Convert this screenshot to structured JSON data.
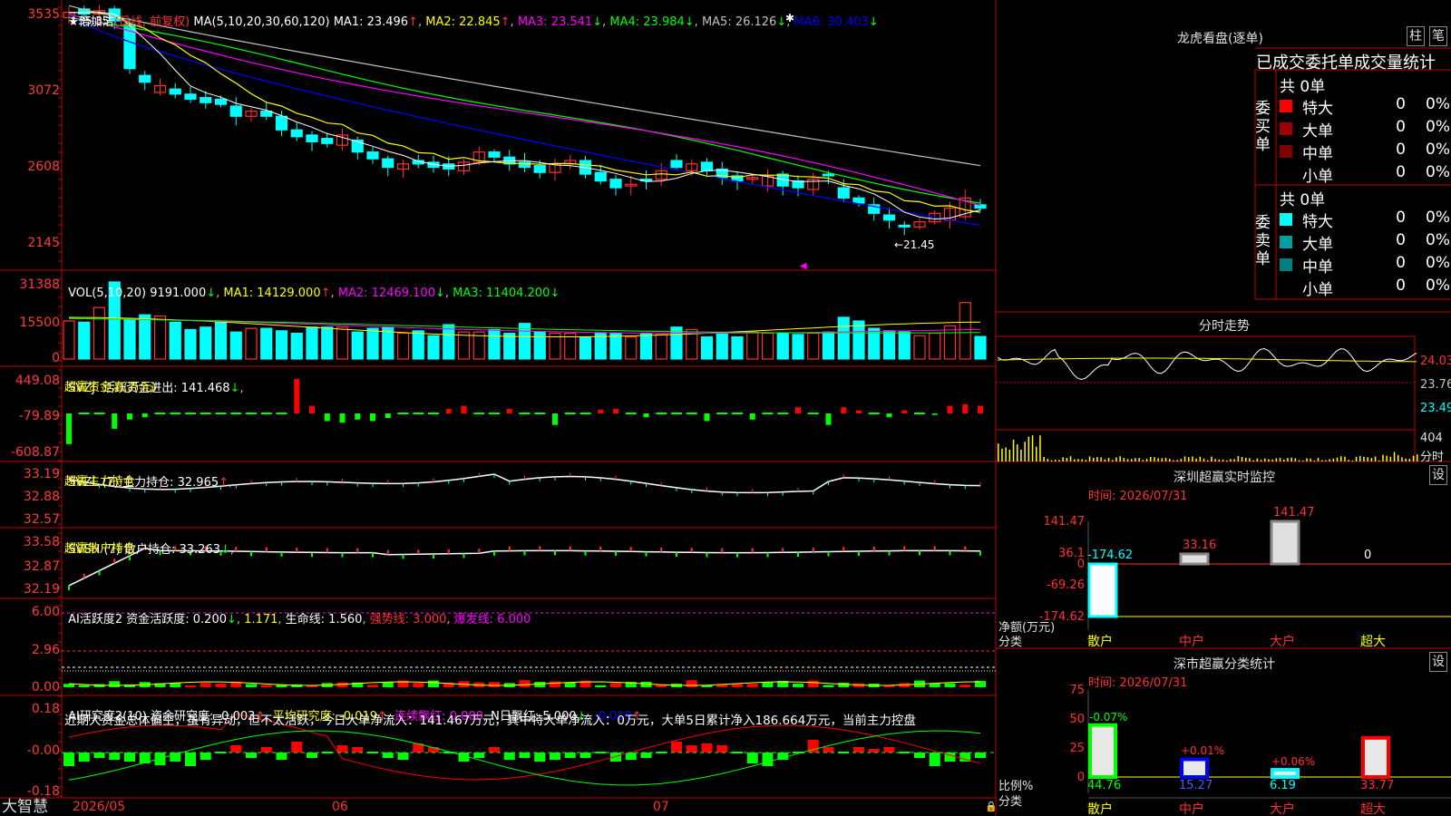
{
  "stock": {
    "star": "★",
    "name": "倍加洁",
    "period": "(日线, 前复权)",
    "ma_params": "MA(5,10,20,30,60,120)",
    "ma": [
      {
        "label": "MA1:",
        "value": "23.496",
        "arrow": "↑",
        "color": "#ffffff"
      },
      {
        "label": "MA2:",
        "value": "22.845",
        "arrow": "↑",
        "color": "#ffff00"
      },
      {
        "label": "MA3:",
        "value": "23.541",
        "arrow": "↓",
        "color": "#ff00ff"
      },
      {
        "label": "MA4:",
        "value": "23.984",
        "arrow": "↓",
        "color": "#00ff00"
      },
      {
        "label": "MA5:",
        "value": "26.126",
        "arrow": "↓",
        "color": "#c0c0c0"
      },
      {
        "label": "MA6:",
        "value": "30.403",
        "arrow": "↓",
        "color": "#0000ff"
      }
    ],
    "high_mark": "35.35",
    "low_mark": "←21.45",
    "y_labels": [
      "3535",
      "3072",
      "2608",
      "2145"
    ]
  },
  "vol": {
    "header": "VOL(5,10,20)",
    "value": "9191.000",
    "value_arrow": "↓",
    "ma": [
      {
        "label": "MA1:",
        "value": "14129.000",
        "arrow": "↑",
        "color": "#ffff00"
      },
      {
        "label": "MA2:",
        "value": "12469.100",
        "arrow": "↓",
        "color": "#ff00ff"
      },
      {
        "label": "MA3:",
        "value": "11404.200",
        "arrow": "↓",
        "color": "#00ff00"
      }
    ],
    "y_labels": [
      "31388",
      "15500",
      "0"
    ]
  },
  "svzj": {
    "header": "SVZJ  活跃资金进出: 141.468",
    "arrow": "↓",
    "sub": "超赢资金流(万元)",
    "y_labels": [
      "449.08",
      "-79.89",
      "-608.87"
    ]
  },
  "svzl": {
    "header": "SVZL (7) 主力持仓: 32.965",
    "arrow": "↑",
    "sub": "超赢主力持仓",
    "y_labels": [
      "33.19",
      "32.88",
      "32.57"
    ]
  },
  "svsh": {
    "header": "SVSH (7) 散户持仓: 33.263",
    "arrow": "↓",
    "sub": "超赢散户持仓",
    "y_labels": [
      "33.58",
      "32.87",
      "32.19"
    ]
  },
  "ai2": {
    "header": "AI活跃度2 资金活跃度: 0.200",
    "arrow": "↓",
    "v2": "1.171",
    "life": "生命线: 1.560",
    "strong": "强势线: 3.000",
    "burst": "爆发线: 6.000",
    "y_labels": [
      "6.00",
      "2.96",
      "0.00"
    ]
  },
  "ai_research": {
    "header": "AI研究度2(10) 资金研究度: -0.003",
    "arrow": "↑",
    "avg": "平均研究度: -0.019",
    "avg_arrow": "↑",
    "red": "连续飘红: 0.000",
    "nday": "N日飘红: 5.000",
    "nday_arrow": "↓",
    "last": "-0.019",
    "last_arrow": "↑",
    "comment": "近期大资金总体偏空，虽有异动，但不太活跃，今日大单净流入：141.467万元，其中特大单净流入：0万元，大单5日累计净入186.664万元，当前主力控盘",
    "y_labels": [
      "0.18",
      "-0.00",
      "-0.18"
    ]
  },
  "footer": {
    "brand": "大智慧",
    "dates": [
      "2026/05",
      "06",
      "07"
    ]
  },
  "dragon": {
    "title": "龙虎看盘(逐单)",
    "btn1": "柱",
    "btn2": "笔",
    "heading": "已成交委托单成交量统计",
    "buy_label": "委买单",
    "sell_label": "委卖单",
    "total_buy": "共 0单",
    "total_sell": "共 0单",
    "buy_rows": [
      {
        "name": "特大",
        "count": "0",
        "pct": "0%",
        "color": "#ff0000"
      },
      {
        "name": "大单",
        "count": "0",
        "pct": "0%",
        "color": "#a00000"
      },
      {
        "name": "中单",
        "count": "0",
        "pct": "0%",
        "color": "#800000"
      },
      {
        "name": "小单",
        "count": "0",
        "pct": "0%",
        "color": ""
      }
    ],
    "sell_rows": [
      {
        "name": "特大",
        "count": "0",
        "pct": "0%",
        "color": "#00ffff"
      },
      {
        "name": "大单",
        "count": "0",
        "pct": "0%",
        "color": "#00a0a0"
      },
      {
        "name": "中单",
        "count": "0",
        "pct": "0%",
        "color": "#008080"
      },
      {
        "name": "小单",
        "count": "0",
        "pct": "0%",
        "color": ""
      }
    ]
  },
  "minute": {
    "title": "分时走势",
    "y_labels": [
      "24.03",
      "23.76",
      "23.49"
    ],
    "vol_label": "404",
    "vol_unit": "分时"
  },
  "sz_monitor": {
    "title": "深圳超赢实时监控",
    "btn": "设",
    "time": "时间: 2026/07/31",
    "y_labels": [
      "141.47",
      "36.1",
      "0",
      "-69.26",
      "-174.62"
    ],
    "ylabel": "净额(万元)",
    "xlabel": "分类",
    "chart_data": {
      "type": "bar",
      "categories": [
        "散户",
        "中户",
        "大户",
        "超大"
      ],
      "values": [
        -174.62,
        33.16,
        141.47,
        0
      ],
      "value_labels": [
        "-174.62",
        "33.16",
        "141.47",
        "0"
      ],
      "ylim": [
        -174.62,
        141.47
      ]
    }
  },
  "sz_class": {
    "title": "深市超赢分类统计",
    "btn": "设",
    "time": "时间: 2026/07/31",
    "y_labels": [
      "75",
      "50",
      "25",
      "0"
    ],
    "ylabel": "比例%",
    "xlabel": "分类",
    "chart_data": {
      "type": "bar",
      "categories": [
        "散户",
        "中户",
        "大户",
        "超大"
      ],
      "values": [
        44.76,
        15.27,
        6.19,
        33.77
      ],
      "deltas": [
        "-0.07%",
        "+0.01%",
        "+0.06%",
        ""
      ],
      "ylim": [
        0,
        75
      ]
    }
  }
}
